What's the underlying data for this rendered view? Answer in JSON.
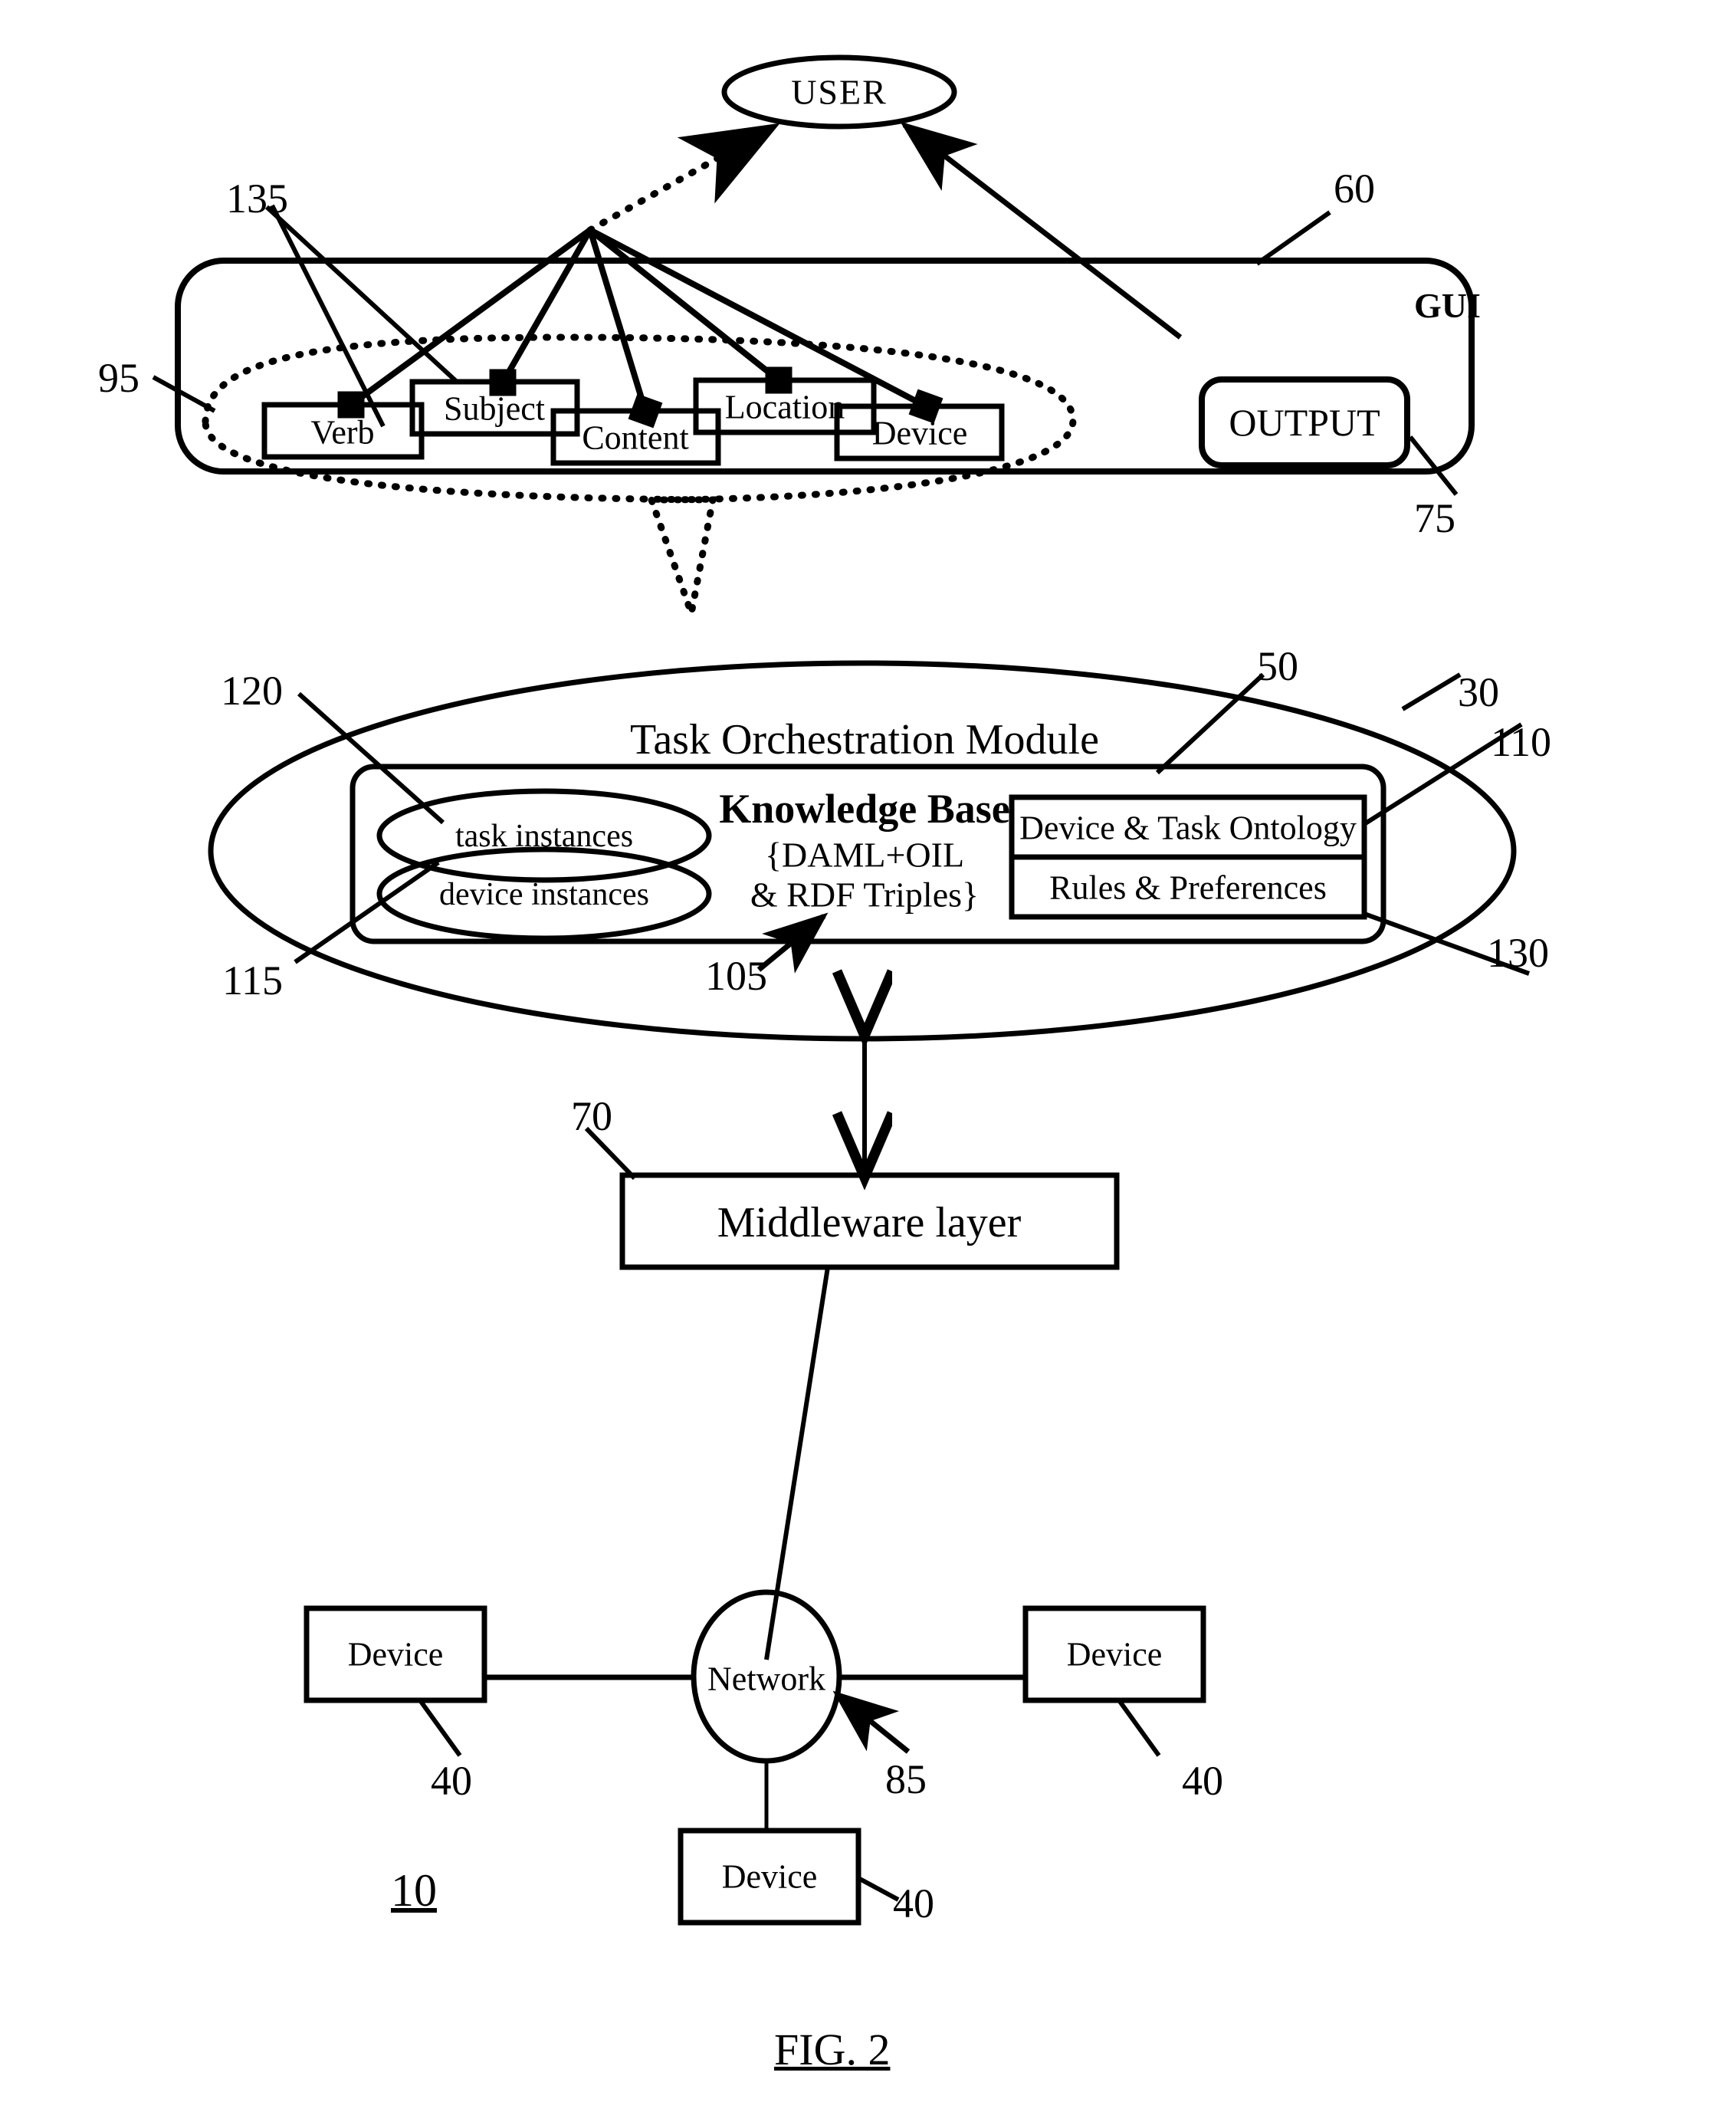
{
  "figure": {
    "caption": "FIG. 2",
    "system_number": "10"
  },
  "user": {
    "label": "USER"
  },
  "gui": {
    "label": "GUI",
    "ref": "60",
    "output": {
      "label": "OUTPUT",
      "ref": "75"
    },
    "callout_ref": "95",
    "connector_ref": "135",
    "fields": [
      {
        "label": "Verb"
      },
      {
        "label": "Subject"
      },
      {
        "label": "Content"
      },
      {
        "label": "Location"
      },
      {
        "label": "Device"
      }
    ]
  },
  "task_orchestration": {
    "title": "Task Orchestration Module",
    "ref": "30",
    "knowledge_base": {
      "title": "Knowledge Base",
      "subtitle_line1": "{DAML+OIL",
      "subtitle_line2": "& RDF Triples}",
      "ref": "50",
      "inner_ref": "105"
    },
    "instances": [
      {
        "label": "task instances",
        "ref": "120"
      },
      {
        "label": "device instances",
        "ref": "115"
      }
    ],
    "ontology_boxes": [
      {
        "label": "Device & Task Ontology",
        "ref": "110"
      },
      {
        "label": "Rules & Preferences",
        "ref": "130"
      }
    ]
  },
  "middleware": {
    "label": "Middleware layer",
    "ref": "70"
  },
  "network": {
    "label": "Network",
    "ref": "85",
    "devices": [
      {
        "label": "Device",
        "ref": "40"
      },
      {
        "label": "Device",
        "ref": "40"
      },
      {
        "label": "Device",
        "ref": "40"
      }
    ]
  }
}
